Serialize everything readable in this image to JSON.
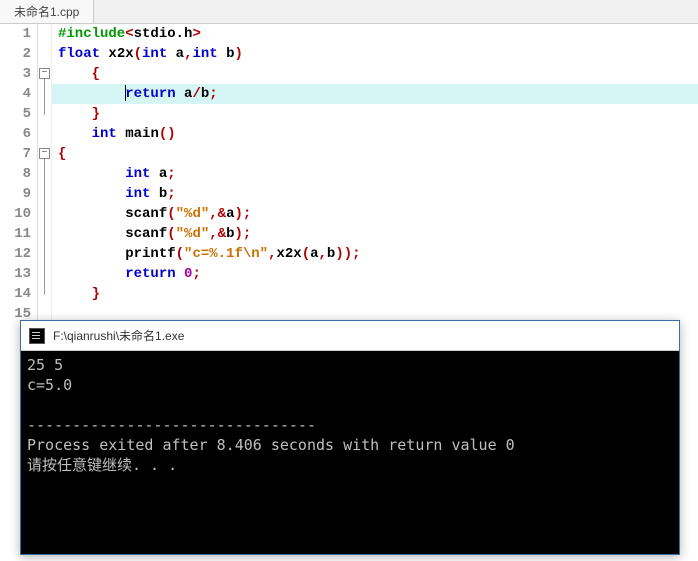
{
  "tab": {
    "title": "未命名1.cpp"
  },
  "code": {
    "lines": [
      {
        "n": 1,
        "tokens": [
          [
            "pp",
            "#include"
          ],
          [
            "punc",
            "<"
          ],
          [
            "plain",
            "stdio.h"
          ],
          [
            "punc",
            ">"
          ]
        ]
      },
      {
        "n": 2,
        "tokens": [
          [
            "type",
            "float"
          ],
          [
            "plain",
            " x2x"
          ],
          [
            "punc",
            "("
          ],
          [
            "type",
            "int"
          ],
          [
            "plain",
            " a"
          ],
          [
            "punc",
            ","
          ],
          [
            "type",
            "int"
          ],
          [
            "plain",
            " b"
          ],
          [
            "punc",
            ")"
          ]
        ]
      },
      {
        "n": 3,
        "indent": 1,
        "tokens": [
          [
            "punc",
            "{"
          ]
        ]
      },
      {
        "n": 4,
        "hl": true,
        "indent": 2,
        "caretBefore": true,
        "tokens": [
          [
            "kw",
            "return"
          ],
          [
            "plain",
            " a"
          ],
          [
            "punc",
            "/"
          ],
          [
            "plain",
            "b"
          ],
          [
            "punc",
            ";"
          ]
        ]
      },
      {
        "n": 5,
        "indent": 1,
        "tokens": [
          [
            "punc",
            "}"
          ]
        ]
      },
      {
        "n": 6,
        "indent": 1,
        "tokens": [
          [
            "type",
            "int"
          ],
          [
            "plain",
            " "
          ],
          [
            "fn",
            "main"
          ],
          [
            "punc",
            "()"
          ]
        ]
      },
      {
        "n": 7,
        "tokens": [
          [
            "punc",
            "{"
          ]
        ]
      },
      {
        "n": 8,
        "indent": 2,
        "tokens": [
          [
            "type",
            "int"
          ],
          [
            "plain",
            " a"
          ],
          [
            "punc",
            ";"
          ]
        ]
      },
      {
        "n": 9,
        "indent": 2,
        "tokens": [
          [
            "type",
            "int"
          ],
          [
            "plain",
            " b"
          ],
          [
            "punc",
            ";"
          ]
        ]
      },
      {
        "n": 10,
        "indent": 2,
        "tokens": [
          [
            "fn",
            "scanf"
          ],
          [
            "punc",
            "("
          ],
          [
            "str",
            "\"%d\""
          ],
          [
            "punc",
            ","
          ],
          [
            "punc",
            "&"
          ],
          [
            "plain",
            "a"
          ],
          [
            "punc",
            ")"
          ],
          [
            "punc",
            ";"
          ]
        ]
      },
      {
        "n": 11,
        "indent": 2,
        "tokens": [
          [
            "fn",
            "scanf"
          ],
          [
            "punc",
            "("
          ],
          [
            "str",
            "\"%d\""
          ],
          [
            "punc",
            ","
          ],
          [
            "punc",
            "&"
          ],
          [
            "plain",
            "b"
          ],
          [
            "punc",
            ")"
          ],
          [
            "punc",
            ";"
          ]
        ]
      },
      {
        "n": 12,
        "indent": 2,
        "tokens": [
          [
            "fn",
            "printf"
          ],
          [
            "punc",
            "("
          ],
          [
            "str",
            "\"c=%.1f\\n\""
          ],
          [
            "punc",
            ","
          ],
          [
            "plain",
            "x2x"
          ],
          [
            "punc",
            "("
          ],
          [
            "plain",
            "a"
          ],
          [
            "punc",
            ","
          ],
          [
            "plain",
            "b"
          ],
          [
            "punc",
            "))"
          ],
          [
            "punc",
            ";"
          ]
        ]
      },
      {
        "n": 13,
        "indent": 2,
        "tokens": [
          [
            "kw",
            "return"
          ],
          [
            "plain",
            " "
          ],
          [
            "num",
            "0"
          ],
          [
            "punc",
            ";"
          ]
        ]
      },
      {
        "n": 14,
        "indent": 1,
        "tokens": [
          [
            "punc",
            "}"
          ]
        ]
      },
      {
        "n": 15,
        "tokens": []
      }
    ],
    "foldMarks": [
      {
        "line": 3,
        "symbol": "−"
      },
      {
        "line": 7,
        "symbol": "−"
      }
    ],
    "foldGuides": [
      {
        "from": 3,
        "to": 5
      },
      {
        "from": 7,
        "to": 14
      }
    ]
  },
  "console": {
    "title": "F:\\qianrushi\\未命名1.exe",
    "output": "25 5\nc=5.0\n\n--------------------------------\nProcess exited after 8.406 seconds with return value 0\n请按任意键继续. . ."
  }
}
